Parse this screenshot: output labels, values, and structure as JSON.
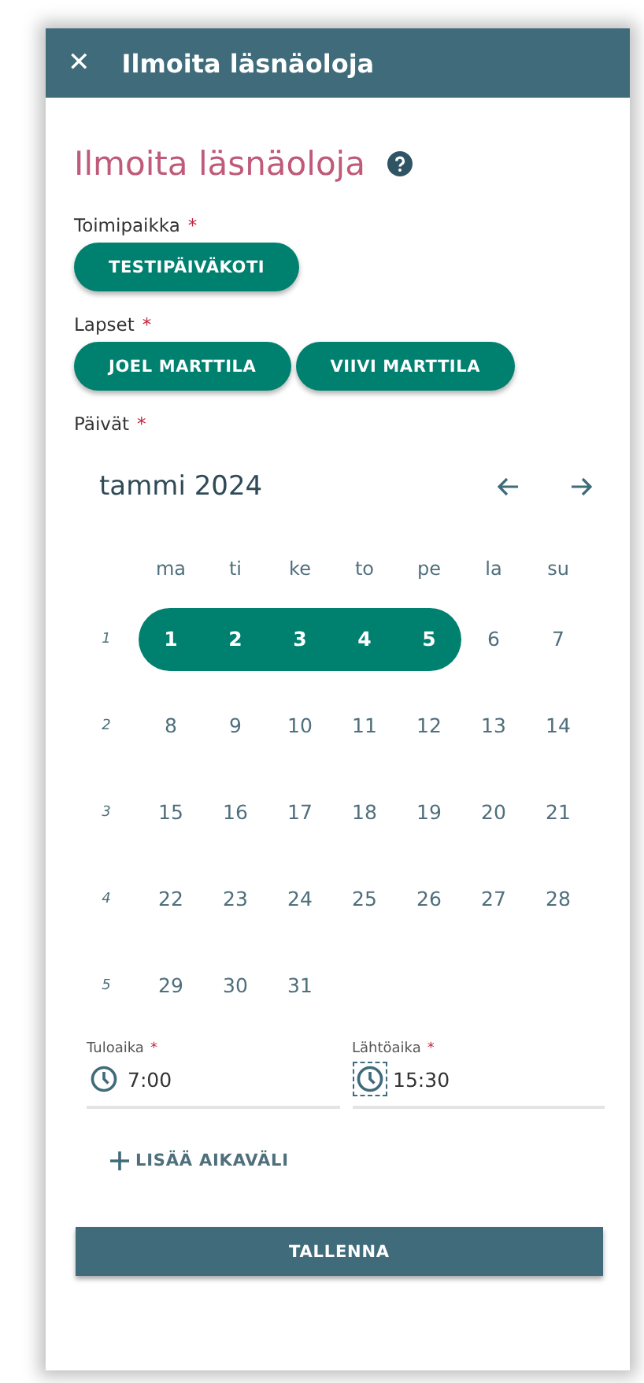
{
  "header": {
    "close_icon": "✕",
    "title": "Ilmoita läsnäoloja"
  },
  "page_title": "Ilmoita läsnäoloja",
  "fields": [
    {
      "label": "Toimipaikka",
      "required_mark": "*",
      "chips": [
        {
          "label": "TESTIPÄIVÄKOTI",
          "selected": true
        }
      ]
    },
    {
      "label": "Lapset",
      "required_mark": "*",
      "chips": [
        {
          "label": "JOEL MARTTILA",
          "selected": true
        },
        {
          "label": "VIIVI MARTTILA",
          "selected": true
        }
      ]
    }
  ],
  "calendar": {
    "label": "Päivät",
    "required_mark": "*",
    "month": "tammi 2024",
    "weekdays": [
      "ma",
      "ti",
      "ke",
      "to",
      "pe",
      "la",
      "su"
    ],
    "weeks": [
      {
        "number": "1",
        "days": [
          {
            "label": "1",
            "selected": true
          },
          {
            "label": "2",
            "selected": true
          },
          {
            "label": "3",
            "selected": true
          },
          {
            "label": "4",
            "selected": true
          },
          {
            "label": "5",
            "selected": true
          },
          {
            "label": "6",
            "selected": false
          },
          {
            "label": "7",
            "selected": false
          }
        ]
      },
      {
        "number": "2",
        "days": [
          {
            "label": "8",
            "selected": false
          },
          {
            "label": "9",
            "selected": false
          },
          {
            "label": "10",
            "selected": false
          },
          {
            "label": "11",
            "selected": false
          },
          {
            "label": "12",
            "selected": false
          },
          {
            "label": "13",
            "selected": false
          },
          {
            "label": "14",
            "selected": false
          }
        ]
      },
      {
        "number": "3",
        "days": [
          {
            "label": "15",
            "selected": false
          },
          {
            "label": "16",
            "selected": false
          },
          {
            "label": "17",
            "selected": false
          },
          {
            "label": "18",
            "selected": false
          },
          {
            "label": "19",
            "selected": false
          },
          {
            "label": "20",
            "selected": false
          },
          {
            "label": "21",
            "selected": false
          }
        ]
      },
      {
        "number": "4",
        "days": [
          {
            "label": "22",
            "selected": false
          },
          {
            "label": "23",
            "selected": false
          },
          {
            "label": "24",
            "selected": false
          },
          {
            "label": "25",
            "selected": false
          },
          {
            "label": "26",
            "selected": false
          },
          {
            "label": "27",
            "selected": false
          },
          {
            "label": "28",
            "selected": false
          }
        ]
      },
      {
        "number": "5",
        "days": [
          {
            "label": "29",
            "selected": false
          },
          {
            "label": "30",
            "selected": false
          },
          {
            "label": "31",
            "selected": false
          }
        ]
      }
    ]
  },
  "times": [
    {
      "label": "Tuloaika",
      "required_mark": "*",
      "value": "7:00",
      "focused": false
    },
    {
      "label": "Lähtöaika",
      "required_mark": "*",
      "value": "15:30",
      "focused": true
    }
  ],
  "add_button": "LISÄÄ AIKAVÄLI",
  "save_button": "TALLENNA"
}
